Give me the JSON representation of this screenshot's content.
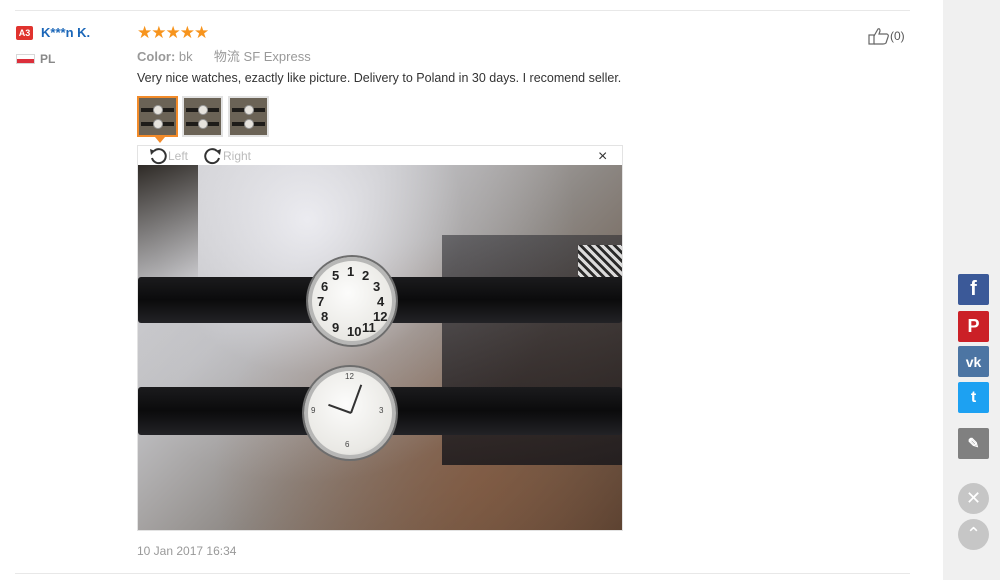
{
  "review": {
    "badge": "A3",
    "username": "K***n K.",
    "country": "PL",
    "rating": 5,
    "stars_text": "★★★★★",
    "color_label": "Color:",
    "color_value": "bk",
    "shipping_label": "物流",
    "shipping_value": "SF Express",
    "text": "Very nice watches, ezactly like picture. Delivery to Poland in 30 days. I recomend seller.",
    "date": "10 Jan 2017 16:34",
    "likes": "(0)"
  },
  "viewer": {
    "rotate_left_label": "Left",
    "rotate_right_label": "Right",
    "close_glyph": "×",
    "active_thumb": 1,
    "dial1_numbers": [
      "1",
      "2",
      "3",
      "4",
      "12",
      "11",
      "10",
      "9",
      "8",
      "7",
      "6",
      "5"
    ],
    "dial2_numbers": [
      "12",
      "3",
      "6",
      "9"
    ]
  },
  "share": {
    "facebook_glyph": "f",
    "pinterest_glyph": "P",
    "vk_glyph": "vk",
    "twitter_glyph": "t",
    "edit_glyph": "✎",
    "close_glyph": "✕",
    "up_glyph": "⌃"
  },
  "colors": {
    "accent": "#f28b2a",
    "stars": "#f7941d",
    "username": "#1a66b8",
    "badge": "#e0332e",
    "facebook": "#3b5998",
    "pinterest": "#cb2027",
    "vk": "#4c75a3",
    "twitter": "#1da1f2"
  }
}
